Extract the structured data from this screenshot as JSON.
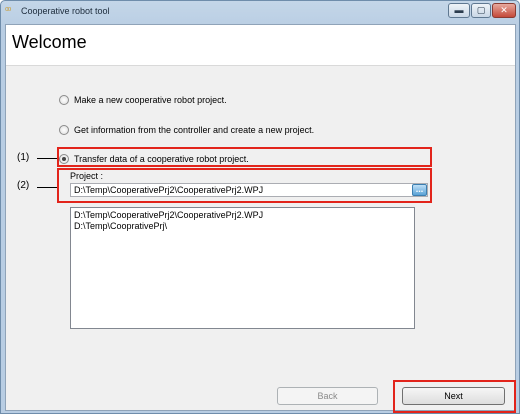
{
  "window": {
    "app_icon": "⁰⁰",
    "title": "Cooperative robot tool",
    "min_symbol": "▬",
    "max_symbol": "▢",
    "close_symbol": "✕"
  },
  "page": {
    "heading": "Welcome"
  },
  "options": [
    {
      "label": "Make a new cooperative robot project.",
      "selected": false
    },
    {
      "label": "Get information from the controller and create a new project.",
      "selected": false
    },
    {
      "label": "Transfer data of a cooperative robot project.",
      "selected": true
    }
  ],
  "project": {
    "label": "Project :",
    "value": "D:\\Temp\\CooperativePrj2\\CooperativePrj2.WPJ",
    "browse_label": "...",
    "recent": [
      "D:\\Temp\\CooperativePrj2\\CooperativePrj2.WPJ",
      "D:\\Temp\\CooprativePrj\\"
    ]
  },
  "callouts": {
    "one": "(1)",
    "two": "(2)"
  },
  "buttons": {
    "back": "Back",
    "next": "Next"
  },
  "colors": {
    "callout": "#e2241b",
    "titlebar": "#b8cde3"
  }
}
